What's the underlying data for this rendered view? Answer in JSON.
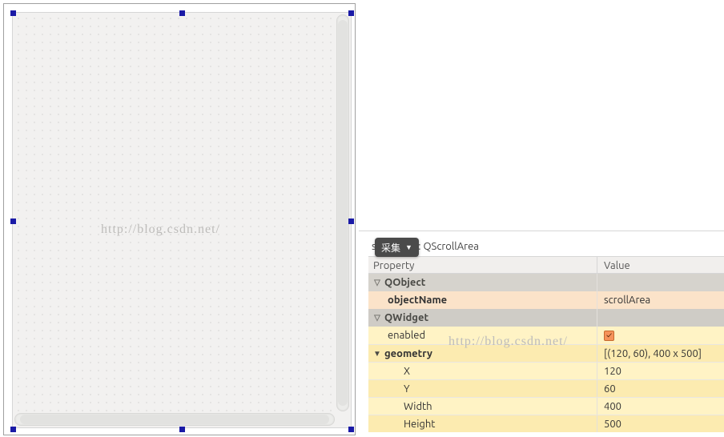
{
  "watermark": "http://blog.csdn.net/",
  "capture_badge": {
    "label": "采集",
    "dropdown_glyph": "▼"
  },
  "object_header": {
    "object_name_part": "sc",
    "object_suffix": "a",
    "class_sep": ": ",
    "class_name": "QScrollArea"
  },
  "table": {
    "header": {
      "property": "Property",
      "value": "Value"
    },
    "groups": {
      "qobject": "QObject",
      "qwidget": "QWidget"
    },
    "rows": {
      "objectName": {
        "label": "objectName",
        "value": "scrollArea"
      },
      "enabled": {
        "label": "enabled",
        "checked": true
      },
      "geometry": {
        "label": "geometry",
        "value": "[(120, 60), 400 x 500]"
      },
      "x": {
        "label": "X",
        "value": "120"
      },
      "y": {
        "label": "Y",
        "value": "60"
      },
      "width": {
        "label": "Width",
        "value": "400"
      },
      "height": {
        "label": "Height",
        "value": "500"
      }
    }
  }
}
